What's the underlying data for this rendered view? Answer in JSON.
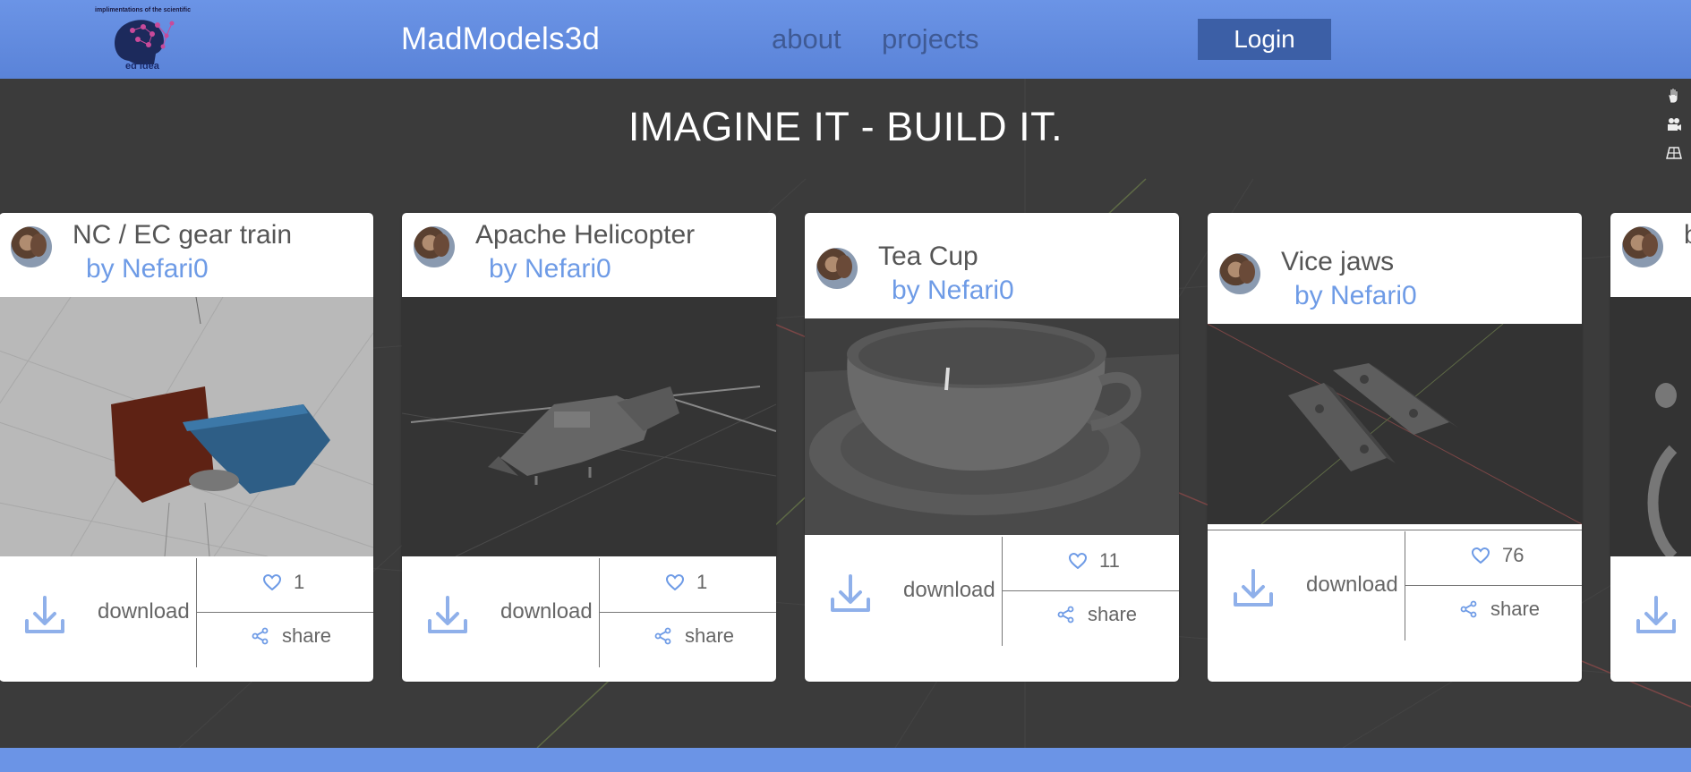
{
  "header": {
    "logo_caption": "implimentations of the scientific",
    "logo_subtext": "ed idea",
    "brand": "MadModels3d",
    "nav": {
      "about": "about",
      "projects": "projects"
    },
    "login_label": "Login"
  },
  "hero": {
    "tagline": "IMAGINE IT - BUILD IT."
  },
  "viewport_controls": [
    "hand-icon",
    "camera-icon",
    "grid-icon"
  ],
  "cards": [
    {
      "title": "NC / EC gear train",
      "author": "by Nefari0",
      "download": "download",
      "likes": "1",
      "share": "share"
    },
    {
      "title": "Apache Helicopter",
      "author": "by Nefari0",
      "download": "download",
      "likes": "1",
      "share": "share"
    },
    {
      "title": "Tea Cup",
      "author": "by Nefari0",
      "download": "download",
      "likes": "11",
      "share": "share"
    },
    {
      "title": "Vice jaws",
      "author": "by Nefari0",
      "download": "download",
      "likes": "76",
      "share": "share"
    },
    {
      "title": "b",
      "author": "",
      "download": "",
      "likes": "",
      "share": ""
    }
  ],
  "colors": {
    "header": "#6b94e6",
    "login_bg": "#3c5fa6",
    "nav_text": "#3f5a94",
    "author": "#6e9be6",
    "background": "#3a3a3a"
  }
}
